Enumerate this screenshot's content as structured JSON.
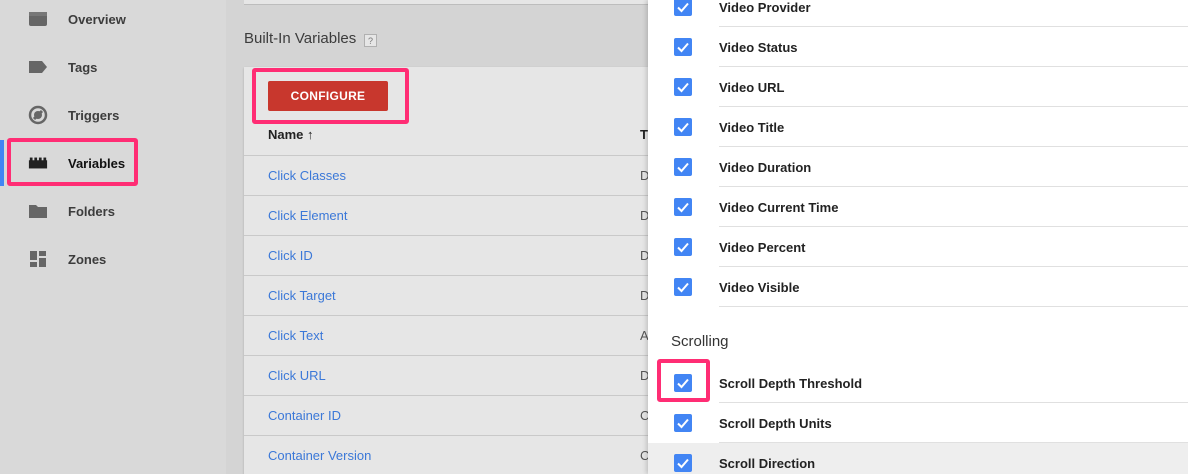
{
  "sidebar": {
    "items": [
      {
        "label": "Overview",
        "icon": "overview-icon"
      },
      {
        "label": "Tags",
        "icon": "tag-icon"
      },
      {
        "label": "Triggers",
        "icon": "trigger-icon"
      },
      {
        "label": "Variables",
        "icon": "variables-icon"
      },
      {
        "label": "Folders",
        "icon": "folder-icon"
      },
      {
        "label": "Zones",
        "icon": "zones-icon"
      }
    ],
    "active": "Variables"
  },
  "main": {
    "section_title": "Built-In Variables",
    "help": "?",
    "configure_label": "CONFIGURE",
    "col_name": "Name ↑",
    "col_type": "T",
    "rows": [
      {
        "name": "Click Classes",
        "type": "D"
      },
      {
        "name": "Click Element",
        "type": "D"
      },
      {
        "name": "Click ID",
        "type": "D"
      },
      {
        "name": "Click Target",
        "type": "D"
      },
      {
        "name": "Click Text",
        "type": "A"
      },
      {
        "name": "Click URL",
        "type": "D"
      },
      {
        "name": "Container ID",
        "type": "C"
      },
      {
        "name": "Container Version",
        "type": "C"
      }
    ]
  },
  "panel": {
    "video_options": [
      {
        "label": "Video Provider",
        "checked": true
      },
      {
        "label": "Video Status",
        "checked": true
      },
      {
        "label": "Video URL",
        "checked": true
      },
      {
        "label": "Video Title",
        "checked": true
      },
      {
        "label": "Video Duration",
        "checked": true
      },
      {
        "label": "Video Current Time",
        "checked": true
      },
      {
        "label": "Video Percent",
        "checked": true
      },
      {
        "label": "Video Visible",
        "checked": true
      }
    ],
    "scrolling_title": "Scrolling",
    "scrolling_options": [
      {
        "label": "Scroll Depth Threshold",
        "checked": true
      },
      {
        "label": "Scroll Depth Units",
        "checked": true
      },
      {
        "label": "Scroll Direction",
        "checked": true
      }
    ]
  },
  "colors": {
    "accent": "#4285f4",
    "configure": "#c8372d",
    "highlight": "#ff2d74",
    "link": "#3b78d8"
  }
}
